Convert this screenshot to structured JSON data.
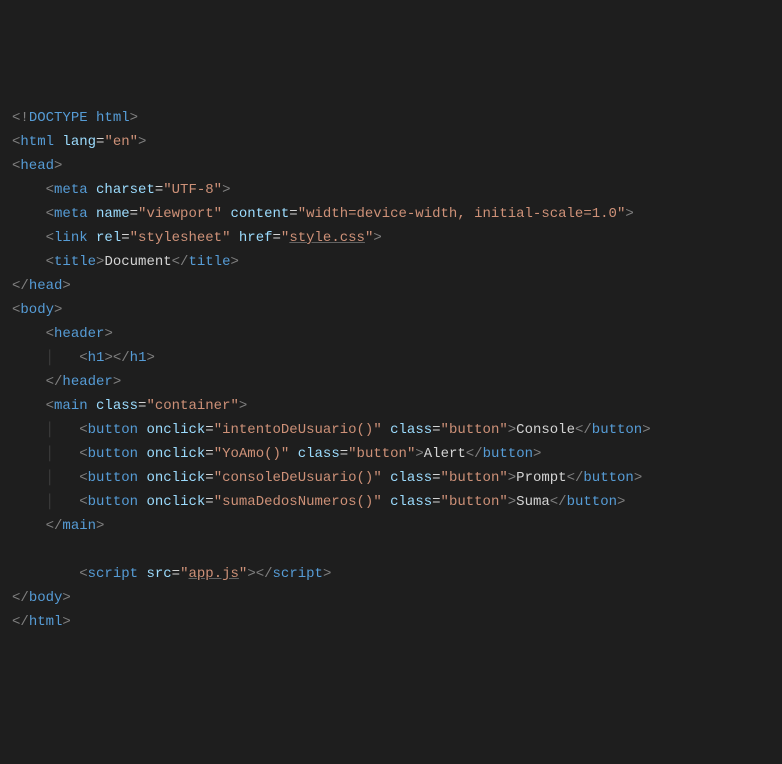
{
  "lines": [
    {
      "indent": 0,
      "segments": [
        {
          "t": "<!",
          "c": "gray"
        },
        {
          "t": "DOCTYPE",
          "c": "doctype"
        },
        {
          "t": " ",
          "c": "txt"
        },
        {
          "t": "html",
          "c": "tag"
        },
        {
          "t": ">",
          "c": "gray"
        }
      ]
    },
    {
      "indent": 0,
      "segments": [
        {
          "t": "<",
          "c": "gray"
        },
        {
          "t": "html",
          "c": "tag"
        },
        {
          "t": " ",
          "c": "txt"
        },
        {
          "t": "lang",
          "c": "attr"
        },
        {
          "t": "=",
          "c": "txt"
        },
        {
          "t": "\"en\"",
          "c": "str"
        },
        {
          "t": ">",
          "c": "gray"
        }
      ]
    },
    {
      "indent": 0,
      "segments": [
        {
          "t": "<",
          "c": "gray"
        },
        {
          "t": "head",
          "c": "tag"
        },
        {
          "t": ">",
          "c": "gray"
        }
      ]
    },
    {
      "indent": 1,
      "segments": [
        {
          "t": "<",
          "c": "gray"
        },
        {
          "t": "meta",
          "c": "tag"
        },
        {
          "t": " ",
          "c": "txt"
        },
        {
          "t": "charset",
          "c": "attr"
        },
        {
          "t": "=",
          "c": "txt"
        },
        {
          "t": "\"UTF-8\"",
          "c": "str"
        },
        {
          "t": ">",
          "c": "gray"
        }
      ]
    },
    {
      "indent": 1,
      "segments": [
        {
          "t": "<",
          "c": "gray"
        },
        {
          "t": "meta",
          "c": "tag"
        },
        {
          "t": " ",
          "c": "txt"
        },
        {
          "t": "name",
          "c": "attr"
        },
        {
          "t": "=",
          "c": "txt"
        },
        {
          "t": "\"viewport\"",
          "c": "str"
        },
        {
          "t": " ",
          "c": "txt"
        },
        {
          "t": "content",
          "c": "attr"
        },
        {
          "t": "=",
          "c": "txt"
        },
        {
          "t": "\"width=device-width, initial-scale=1.0\"",
          "c": "str"
        },
        {
          "t": ">",
          "c": "gray"
        }
      ]
    },
    {
      "indent": 1,
      "segments": [
        {
          "t": "<",
          "c": "gray"
        },
        {
          "t": "link",
          "c": "tag"
        },
        {
          "t": " ",
          "c": "txt"
        },
        {
          "t": "rel",
          "c": "attr"
        },
        {
          "t": "=",
          "c": "txt"
        },
        {
          "t": "\"stylesheet\"",
          "c": "str"
        },
        {
          "t": " ",
          "c": "txt"
        },
        {
          "t": "href",
          "c": "attr"
        },
        {
          "t": "=",
          "c": "txt"
        },
        {
          "t": "\"",
          "c": "str"
        },
        {
          "t": "style.css",
          "c": "str underline"
        },
        {
          "t": "\"",
          "c": "str"
        },
        {
          "t": ">",
          "c": "gray"
        }
      ]
    },
    {
      "indent": 1,
      "segments": [
        {
          "t": "<",
          "c": "gray"
        },
        {
          "t": "title",
          "c": "tag"
        },
        {
          "t": ">",
          "c": "gray"
        },
        {
          "t": "Document",
          "c": "txt"
        },
        {
          "t": "</",
          "c": "gray"
        },
        {
          "t": "title",
          "c": "tag"
        },
        {
          "t": ">",
          "c": "gray"
        }
      ]
    },
    {
      "indent": 0,
      "segments": [
        {
          "t": "</",
          "c": "gray"
        },
        {
          "t": "head",
          "c": "tag"
        },
        {
          "t": ">",
          "c": "gray"
        }
      ]
    },
    {
      "indent": 0,
      "segments": [
        {
          "t": "<",
          "c": "gray"
        },
        {
          "t": "body",
          "c": "tag"
        },
        {
          "t": ">",
          "c": "gray"
        }
      ]
    },
    {
      "indent": 1,
      "segments": [
        {
          "t": "<",
          "c": "gray"
        },
        {
          "t": "header",
          "c": "tag"
        },
        {
          "t": ">",
          "c": "gray"
        }
      ]
    },
    {
      "indent": 2,
      "guide": true,
      "segments": [
        {
          "t": "<",
          "c": "gray"
        },
        {
          "t": "h1",
          "c": "tag"
        },
        {
          "t": "></",
          "c": "gray"
        },
        {
          "t": "h1",
          "c": "tag"
        },
        {
          "t": ">",
          "c": "gray"
        }
      ]
    },
    {
      "indent": 1,
      "segments": [
        {
          "t": "</",
          "c": "gray"
        },
        {
          "t": "header",
          "c": "tag"
        },
        {
          "t": ">",
          "c": "gray"
        }
      ]
    },
    {
      "indent": 1,
      "segments": [
        {
          "t": "<",
          "c": "gray"
        },
        {
          "t": "main",
          "c": "tag"
        },
        {
          "t": " ",
          "c": "txt"
        },
        {
          "t": "class",
          "c": "attr"
        },
        {
          "t": "=",
          "c": "txt"
        },
        {
          "t": "\"container\"",
          "c": "str"
        },
        {
          "t": ">",
          "c": "gray"
        }
      ]
    },
    {
      "indent": 2,
      "guide": true,
      "segments": [
        {
          "t": "<",
          "c": "gray"
        },
        {
          "t": "button",
          "c": "tag"
        },
        {
          "t": " ",
          "c": "txt"
        },
        {
          "t": "onclick",
          "c": "attr"
        },
        {
          "t": "=",
          "c": "txt"
        },
        {
          "t": "\"intentoDeUsuario()\"",
          "c": "str"
        },
        {
          "t": " ",
          "c": "txt"
        },
        {
          "t": "class",
          "c": "attr"
        },
        {
          "t": "=",
          "c": "txt"
        },
        {
          "t": "\"button\"",
          "c": "str"
        },
        {
          "t": ">",
          "c": "gray"
        },
        {
          "t": "Console",
          "c": "txt"
        },
        {
          "t": "</",
          "c": "gray"
        },
        {
          "t": "button",
          "c": "tag"
        },
        {
          "t": ">",
          "c": "gray"
        }
      ]
    },
    {
      "indent": 2,
      "guide": true,
      "segments": [
        {
          "t": "<",
          "c": "gray"
        },
        {
          "t": "button",
          "c": "tag"
        },
        {
          "t": " ",
          "c": "txt"
        },
        {
          "t": "onclick",
          "c": "attr"
        },
        {
          "t": "=",
          "c": "txt"
        },
        {
          "t": "\"YoAmo()\"",
          "c": "str"
        },
        {
          "t": " ",
          "c": "txt"
        },
        {
          "t": "class",
          "c": "attr"
        },
        {
          "t": "=",
          "c": "txt"
        },
        {
          "t": "\"button\"",
          "c": "str"
        },
        {
          "t": ">",
          "c": "gray"
        },
        {
          "t": "Alert",
          "c": "txt"
        },
        {
          "t": "</",
          "c": "gray"
        },
        {
          "t": "button",
          "c": "tag"
        },
        {
          "t": ">",
          "c": "gray"
        }
      ]
    },
    {
      "indent": 2,
      "guide": true,
      "segments": [
        {
          "t": "<",
          "c": "gray"
        },
        {
          "t": "button",
          "c": "tag"
        },
        {
          "t": " ",
          "c": "txt"
        },
        {
          "t": "onclick",
          "c": "attr"
        },
        {
          "t": "=",
          "c": "txt"
        },
        {
          "t": "\"consoleDeUsuario()\"",
          "c": "str"
        },
        {
          "t": " ",
          "c": "txt"
        },
        {
          "t": "class",
          "c": "attr"
        },
        {
          "t": "=",
          "c": "txt"
        },
        {
          "t": "\"button\"",
          "c": "str"
        },
        {
          "t": ">",
          "c": "gray"
        },
        {
          "t": "Prompt",
          "c": "txt"
        },
        {
          "t": "</",
          "c": "gray"
        },
        {
          "t": "button",
          "c": "tag"
        },
        {
          "t": ">",
          "c": "gray"
        }
      ]
    },
    {
      "indent": 2,
      "guide": true,
      "segments": [
        {
          "t": "<",
          "c": "gray"
        },
        {
          "t": "button",
          "c": "tag"
        },
        {
          "t": " ",
          "c": "txt"
        },
        {
          "t": "onclick",
          "c": "attr"
        },
        {
          "t": "=",
          "c": "txt"
        },
        {
          "t": "\"sumaDedosNumeros()\"",
          "c": "str"
        },
        {
          "t": " ",
          "c": "txt"
        },
        {
          "t": "class",
          "c": "attr"
        },
        {
          "t": "=",
          "c": "txt"
        },
        {
          "t": "\"button\"",
          "c": "str"
        },
        {
          "t": ">",
          "c": "gray"
        },
        {
          "t": "Suma",
          "c": "txt"
        },
        {
          "t": "</",
          "c": "gray"
        },
        {
          "t": "button",
          "c": "tag"
        },
        {
          "t": ">",
          "c": "gray"
        }
      ]
    },
    {
      "indent": 1,
      "segments": [
        {
          "t": "</",
          "c": "gray"
        },
        {
          "t": "main",
          "c": "tag"
        },
        {
          "t": ">",
          "c": "gray"
        }
      ]
    },
    {
      "indent": 0,
      "segments": [
        {
          "t": " ",
          "c": "txt"
        }
      ]
    },
    {
      "indent": 2,
      "segments": [
        {
          "t": "<",
          "c": "gray"
        },
        {
          "t": "script",
          "c": "tag"
        },
        {
          "t": " ",
          "c": "txt"
        },
        {
          "t": "src",
          "c": "attr"
        },
        {
          "t": "=",
          "c": "txt"
        },
        {
          "t": "\"",
          "c": "str"
        },
        {
          "t": "app.js",
          "c": "str underline"
        },
        {
          "t": "\"",
          "c": "str"
        },
        {
          "t": "></",
          "c": "gray"
        },
        {
          "t": "script",
          "c": "tag"
        },
        {
          "t": ">",
          "c": "gray"
        }
      ]
    },
    {
      "indent": 0,
      "segments": [
        {
          "t": "</",
          "c": "gray"
        },
        {
          "t": "body",
          "c": "tag"
        },
        {
          "t": ">",
          "c": "gray"
        }
      ]
    },
    {
      "indent": 0,
      "segments": [
        {
          "t": "</",
          "c": "gray"
        },
        {
          "t": "html",
          "c": "tag"
        },
        {
          "t": ">",
          "c": "gray"
        }
      ]
    }
  ]
}
